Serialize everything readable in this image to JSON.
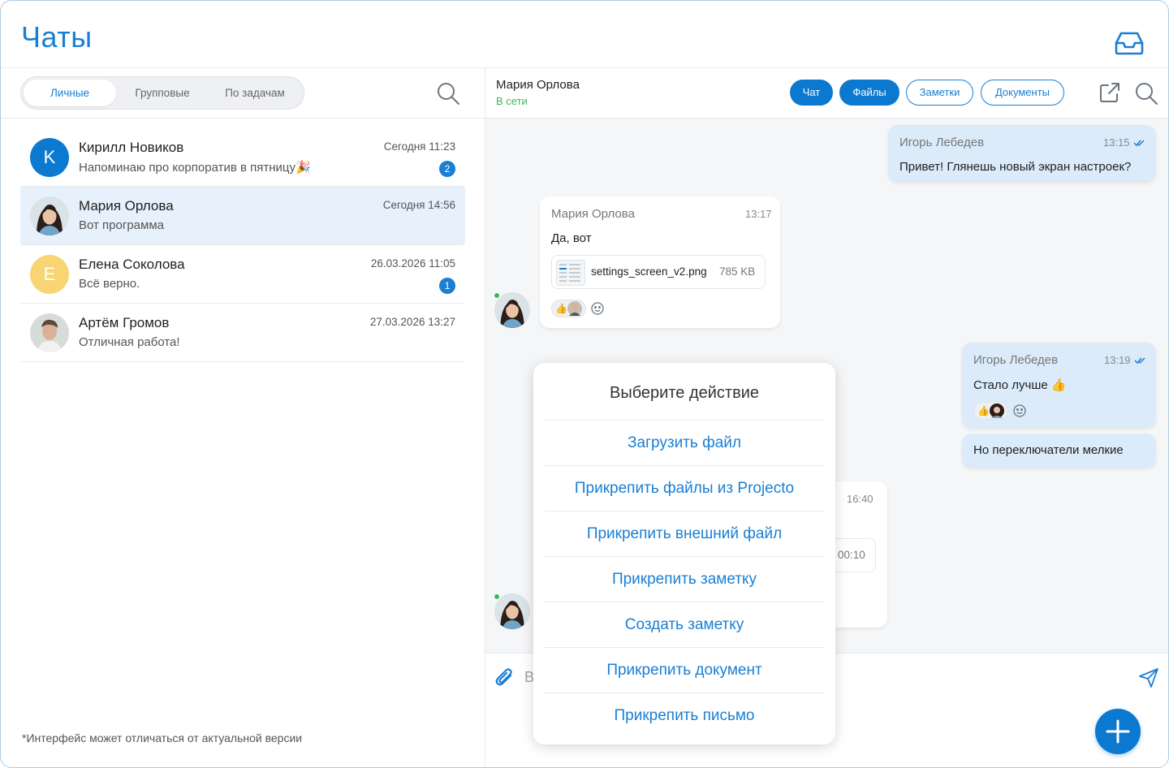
{
  "app": {
    "title": "Чаты"
  },
  "sidebar": {
    "tabs": [
      {
        "label": "Личные",
        "active": true
      },
      {
        "label": "Групповые",
        "active": false
      },
      {
        "label": "По задачам",
        "active": false
      }
    ],
    "chats": [
      {
        "name": "Кирилл Новиков",
        "preview": "Напоминаю про корпоратив в пятницу🎉",
        "time": "Сегодня 11:23",
        "unread": "2",
        "avatar_letter": "K",
        "avatar_color": "#0b79d0",
        "selected": false
      },
      {
        "name": "Мария Орлова",
        "preview": "Вот программа",
        "time": "Сегодня 14:56",
        "unread": "",
        "avatar_letter": "",
        "avatar_color": "#3b2a24",
        "selected": true
      },
      {
        "name": "Елена Соколова",
        "preview": "Всё верно.",
        "time": "26.03.2026 11:05",
        "unread": "1",
        "avatar_letter": "E",
        "avatar_color": "#f8d572",
        "selected": false
      },
      {
        "name": "Артём Громов",
        "preview": "Отличная работа!",
        "time": "27.03.2026 13:27",
        "unread": "",
        "avatar_letter": "",
        "avatar_color": "#8a7a6d",
        "selected": false
      }
    ],
    "footnote": "*Интерфейс может отличаться от актуальной версии"
  },
  "conversation": {
    "name": "Мария Орлова",
    "status": "В сети",
    "tabs": [
      "Чат",
      "Файлы",
      "Заметки",
      "Документы"
    ],
    "messages": {
      "m1": {
        "author": "Игорь Лебедев",
        "time": "13:15",
        "text": "Привет! Глянешь новый экран настроек?"
      },
      "m2": {
        "author": "Мария Орлова",
        "time": "13:17",
        "text": "Да, вот",
        "file_name": "settings_screen_v2.png",
        "file_size": "785 KB"
      },
      "m3": {
        "author": "Игорь Лебедев",
        "time": "13:19",
        "text": "Стало лучше 👍"
      },
      "m4": {
        "text": "Но переключатели мелкие"
      },
      "m5": {
        "time": "16:40",
        "audio_duration": "00:10"
      }
    },
    "composer_placeholder": "В"
  },
  "action_sheet": {
    "title": "Выберите действие",
    "items": [
      "Загрузить файл",
      "Прикрепить файлы из Projecto",
      "Прикрепить внешний файл",
      "Прикрепить заметку",
      "Создать заметку",
      "Прикрепить документ",
      "Прикрепить письмо"
    ]
  },
  "colors": {
    "accent": "#1a7fd4",
    "online": "#3cb65a",
    "selected_row": "#e6f1fb",
    "outgoing_bubble": "#dcebfa"
  }
}
